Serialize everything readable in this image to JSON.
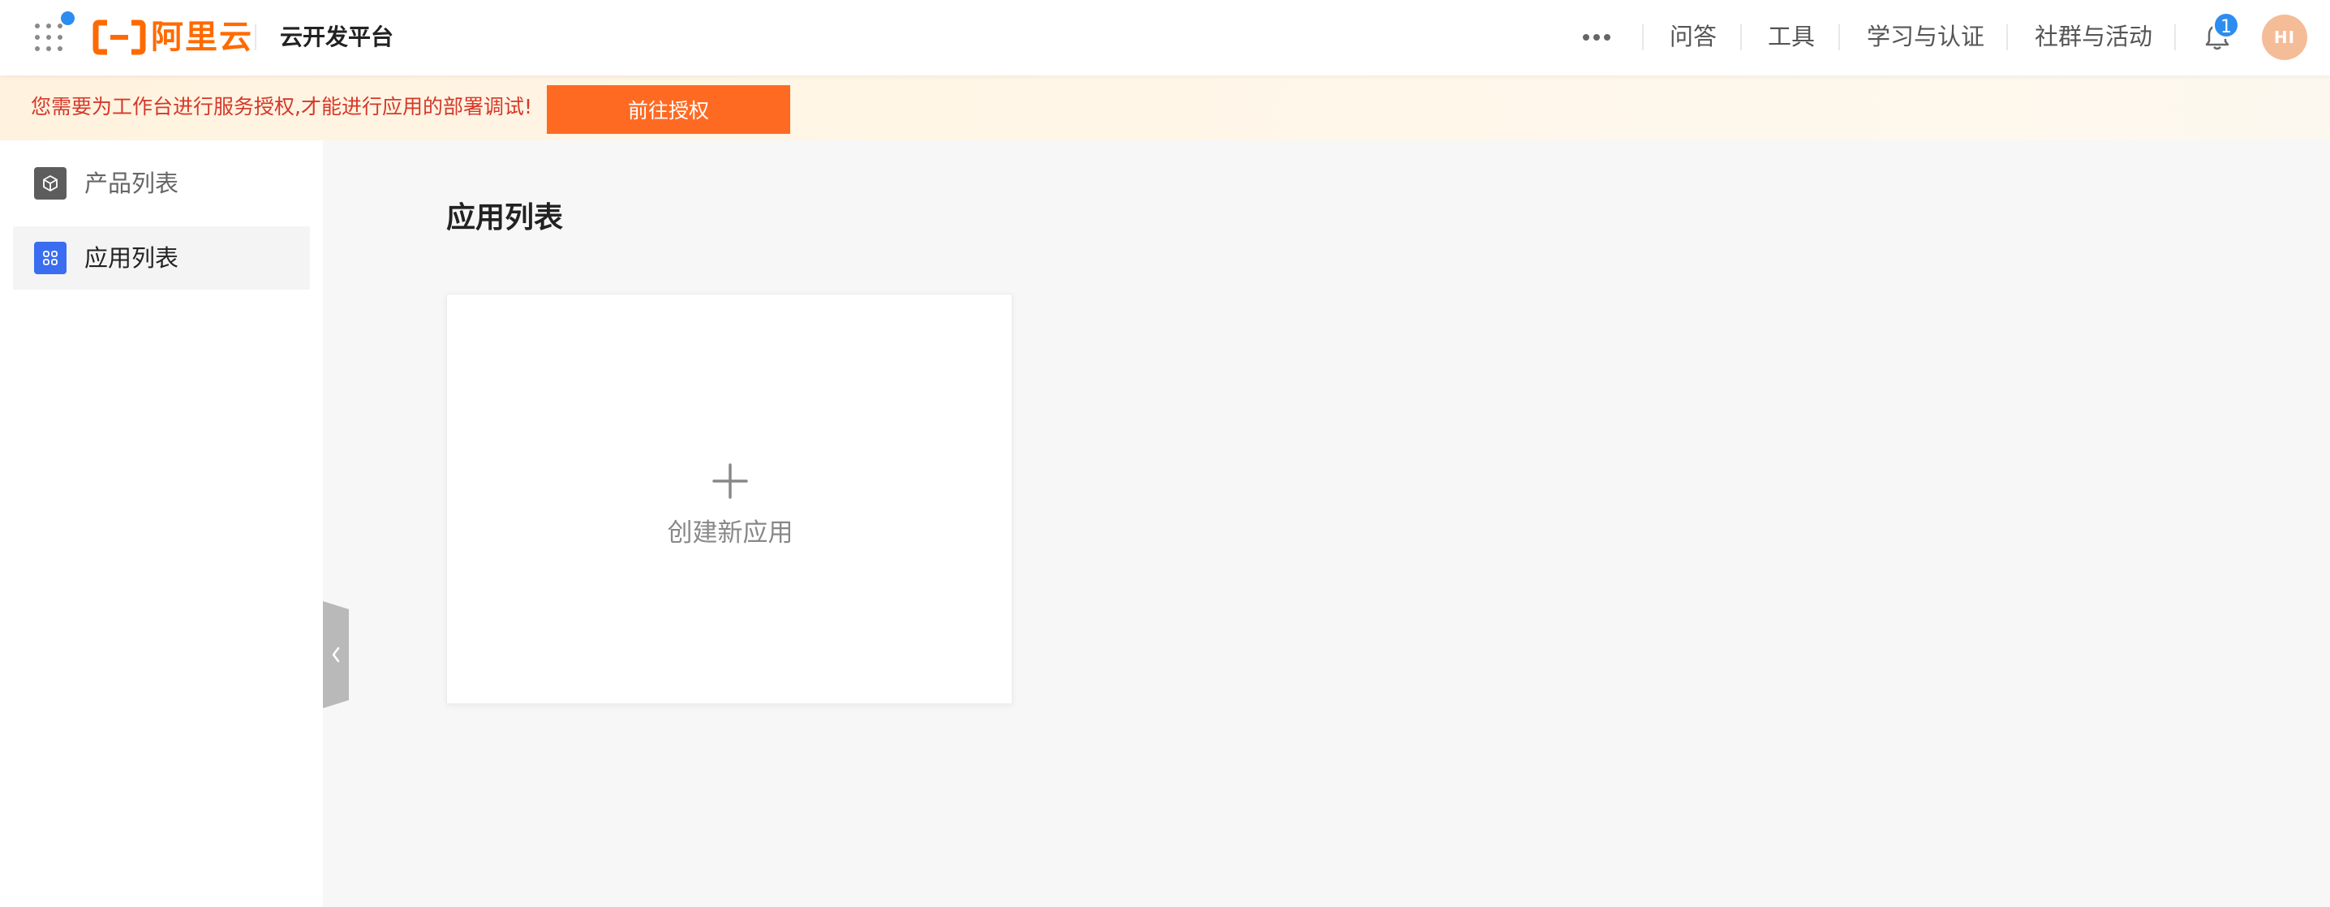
{
  "header": {
    "logo_text": "阿里云",
    "product_title": "云开发平台",
    "nav_links": [
      "问答",
      "工具",
      "学习与认证",
      "社群与活动"
    ],
    "notification_count": "1",
    "avatar_initials": "HI"
  },
  "banner": {
    "message": "您需要为工作台进行服务授权,才能进行应用的部署调试!",
    "action_label": "前往授权"
  },
  "sidebar": {
    "items": [
      {
        "label": "产品列表",
        "icon": "cube-icon",
        "active": false
      },
      {
        "label": "应用列表",
        "icon": "apps-grid-icon",
        "active": true
      }
    ]
  },
  "main": {
    "title": "应用列表",
    "create_card_label": "创建新应用"
  },
  "colors": {
    "brand": "#ff6a00",
    "banner_button": "#ff6a23",
    "banner_text": "#d6382a",
    "accent_blue": "#2d8cf0",
    "sidebar_active_icon": "#3a6df0"
  }
}
